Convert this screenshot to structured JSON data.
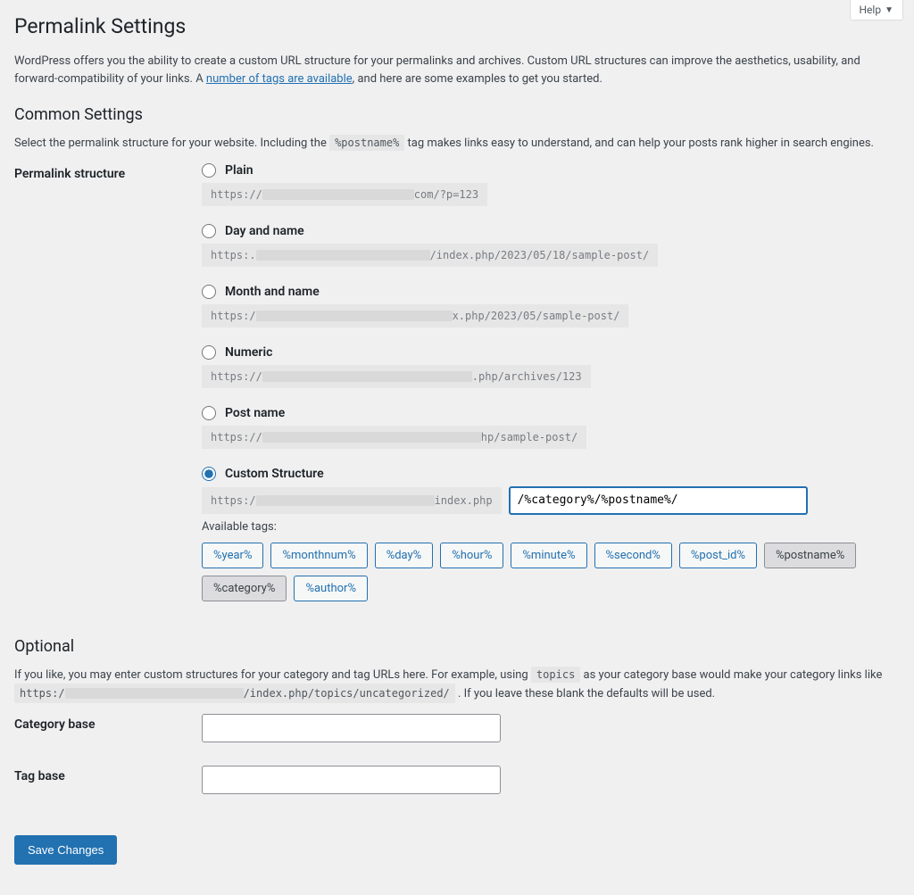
{
  "help_label": "Help",
  "page_title": "Permalink Settings",
  "intro": {
    "before": "WordPress offers you the ability to create a custom URL structure for your permalinks and archives. Custom URL structures can improve the aesthetics, usability, and forward-compatibility of your links. A ",
    "link": "number of tags are available",
    "after": ", and here are some examples to get you started."
  },
  "common_heading": "Common Settings",
  "common_desc": {
    "before": "Select the permalink structure for your website. Including the ",
    "code": "%postname%",
    "after": " tag makes links easy to understand, and can help your posts rank higher in search engines."
  },
  "structure_label": "Permalink structure",
  "options": {
    "plain": {
      "label": "Plain",
      "pre": "https://",
      "post": "com/?p=123"
    },
    "day_name": {
      "label": "Day and name",
      "pre": "https:.",
      "post": "/index.php/2023/05/18/sample-post/"
    },
    "month_name": {
      "label": "Month and name",
      "pre": "https:/",
      "post": "x.php/2023/05/sample-post/"
    },
    "numeric": {
      "label": "Numeric",
      "pre": "https://",
      "post": ".php/archives/123"
    },
    "post_name": {
      "label": "Post name",
      "pre": "https://",
      "post": "hp/sample-post/"
    },
    "custom": {
      "label": "Custom Structure",
      "pre": "https:/",
      "post": "index.php",
      "value": "/%category%/%postname%/"
    }
  },
  "available_tags_label": "Available tags:",
  "tags": [
    {
      "t": "%year%",
      "sel": false
    },
    {
      "t": "%monthnum%",
      "sel": false
    },
    {
      "t": "%day%",
      "sel": false
    },
    {
      "t": "%hour%",
      "sel": false
    },
    {
      "t": "%minute%",
      "sel": false
    },
    {
      "t": "%second%",
      "sel": false
    },
    {
      "t": "%post_id%",
      "sel": false
    },
    {
      "t": "%postname%",
      "sel": true
    },
    {
      "t": "%category%",
      "sel": true
    },
    {
      "t": "%author%",
      "sel": false
    }
  ],
  "optional_heading": "Optional",
  "optional_desc": {
    "p1_before": "If you like, you may enter custom structures for your category and tag URLs here. For example, using ",
    "p1_code": "topics",
    "p1_after": " as your category base would make your category links like ",
    "p2_pre": "https:/",
    "p2_post": "/index.php/topics/uncategorized/",
    "p2_after": " . If you leave these blank the defaults will be used."
  },
  "category_base_label": "Category base",
  "tag_base_label": "Tag base",
  "save_label": "Save Changes"
}
